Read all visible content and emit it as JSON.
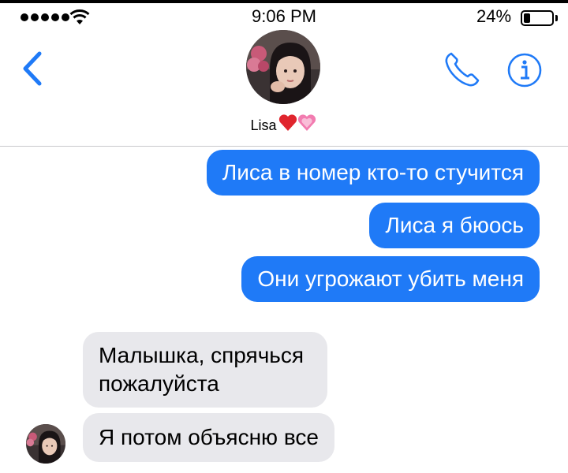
{
  "status_bar": {
    "time": "9:06 PM",
    "battery_percent": "24%",
    "battery_level": 0.24,
    "signal_dots": 5
  },
  "header": {
    "contact_name": "Lisa",
    "back_icon": "chevron-left-icon",
    "call_icon": "phone-icon",
    "info_icon": "info-icon",
    "accent_color": "#1f7af7"
  },
  "messages": [
    {
      "direction": "outgoing",
      "text": "Лиса в номер кто-то стучится"
    },
    {
      "direction": "outgoing",
      "text": "Лиса я бюось"
    },
    {
      "direction": "outgoing",
      "text": "Они угрожают убить меня"
    },
    {
      "direction": "incoming",
      "text": "Малышка, спрячься пожалуйста"
    },
    {
      "direction": "incoming",
      "text": "Я потом объясню все"
    }
  ],
  "colors": {
    "outgoing_bubble": "#1f7af7",
    "incoming_bubble": "#e8e8ec"
  }
}
